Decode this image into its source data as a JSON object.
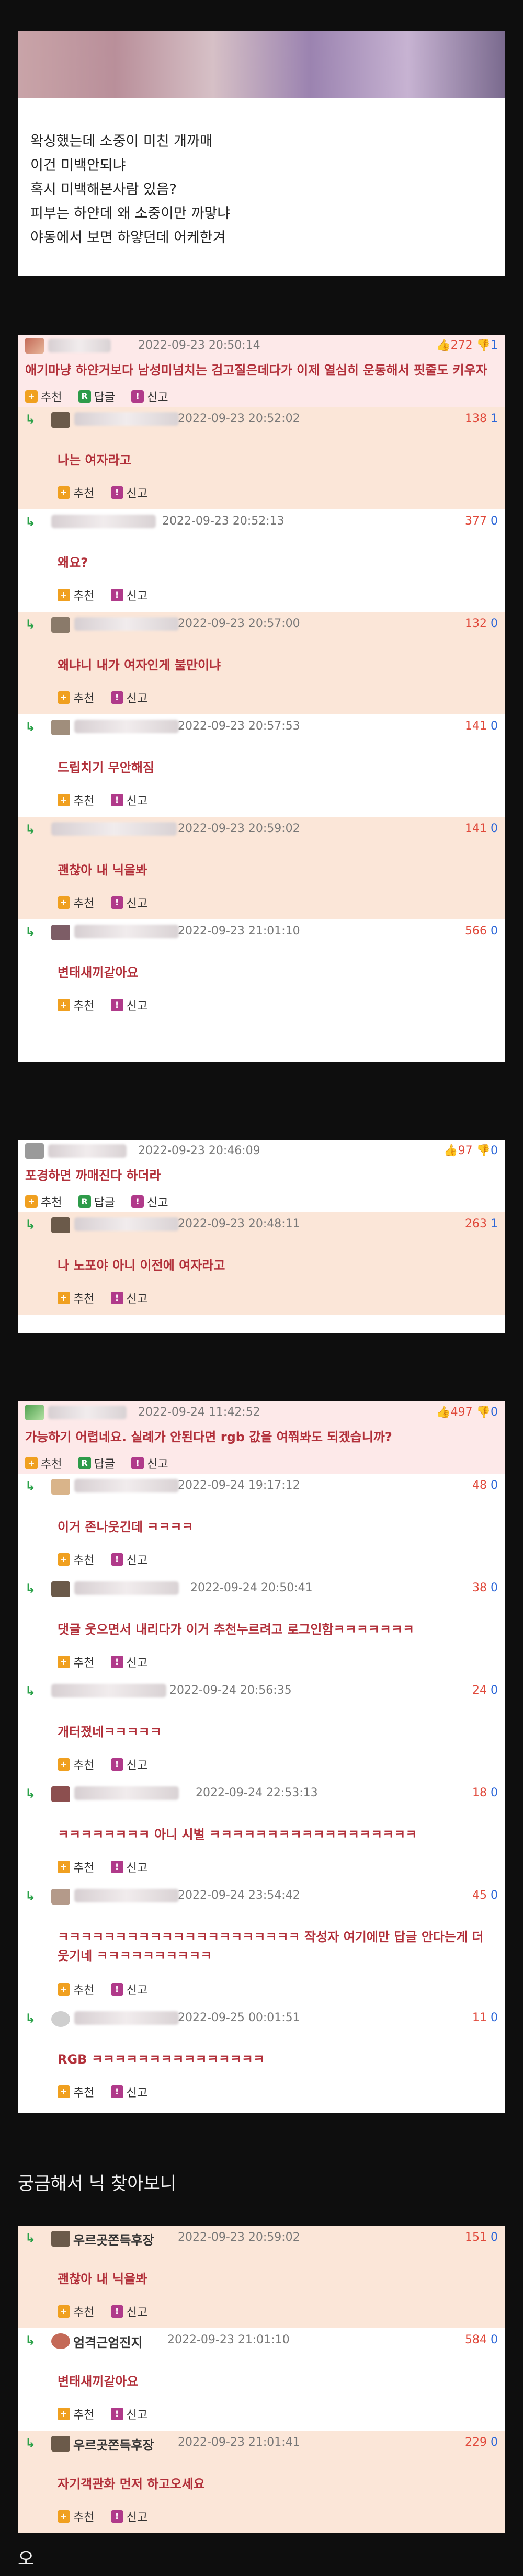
{
  "caption": {
    "lines": [
      "왁싱했는데 소중이 미친 개까매",
      "이건 미백안되냐",
      "혹시 미백해본사람 있음?",
      "피부는 하얀데 왜 소중이만 까맣냐",
      "야동에서 보면 하얗던데 어케한겨"
    ]
  },
  "labels": {
    "rec": "추천",
    "ans": "답글",
    "rep": "신고"
  },
  "thread1": {
    "ts": "2022-09-23 20:50:14",
    "up": "272",
    "down": "1",
    "text": "애기마냥 하얀거보다 남성미넘치는 검고질은데다가 이제 열심히 운동해서 핏줄도 키우자",
    "replies": [
      {
        "ts": "2022-09-23 20:52:02",
        "text": "나는 여자라고",
        "up": "138",
        "down": "1"
      },
      {
        "ts": "2022-09-23 20:52:13",
        "text": "왜요?",
        "up": "377",
        "down": "0"
      },
      {
        "ts": "2022-09-23 20:57:00",
        "text": "왜냐니 내가 여자인게 불만이냐",
        "up": "132",
        "down": "0"
      },
      {
        "ts": "2022-09-23 20:57:53",
        "text": "드립치기 무안해짐",
        "up": "141",
        "down": "0"
      },
      {
        "ts": "2022-09-23 20:59:02",
        "text": "괜찮아 내 닉을봐",
        "up": "141",
        "down": "0"
      },
      {
        "ts": "2022-09-23 21:01:10",
        "text": "변태새끼같아요",
        "up": "566",
        "down": "0"
      }
    ]
  },
  "thread2": {
    "ts": "2022-09-23 20:46:09",
    "up": "97",
    "down": "0",
    "text": "포경하면 까매진다 하더라",
    "replies": [
      {
        "ts": "2022-09-23 20:48:11",
        "text": "나 노포야 아니 이전에 여자라고",
        "up": "263",
        "down": "1"
      }
    ]
  },
  "thread3": {
    "ts": "2022-09-24 11:42:52",
    "up": "497",
    "down": "0",
    "text": "가능하기 어렵네요. 실례가 안된다면 rgb 값을 여쭤봐도 되겠습니까?",
    "replies": [
      {
        "ts": "2022-09-24 19:17:12",
        "text": "이거 존나웃긴데 ㅋㅋㅋㅋ",
        "up": "48",
        "down": "0"
      },
      {
        "ts": "2022-09-24 20:50:41",
        "text": "댓글 웃으면서 내리다가 이거 추천누르려고 로그인함ㅋㅋㅋㅋㅋㅋㅋ",
        "up": "38",
        "down": "0"
      },
      {
        "ts": "2022-09-24 20:56:35",
        "text": "개터졌네ㅋㅋㅋㅋㅋ",
        "up": "24",
        "down": "0"
      },
      {
        "ts": "2022-09-24 22:53:13",
        "text": "ㅋㅋㅋㅋㅋㅋㅋㅋ 아니 시벌 ㅋㅋㅋㅋㅋㅋㅋㅋㅋㅋㅋㅋㅋㅋㅋㅋㅋㅋ",
        "up": "18",
        "down": "0"
      },
      {
        "ts": "2022-09-24 23:54:42",
        "text": "ㅋㅋㅋㅋㅋㅋㅋㅋㅋㅋㅋㅋㅋㅋㅋㅋㅋㅋㅋㅋㅋ 작성자 여기에만 답글 안다는게 더 웃기네 ㅋㅋㅋㅋㅋㅋㅋㅋㅋㅋ",
        "up": "45",
        "down": "0"
      },
      {
        "ts": "2022-09-25 00:01:51",
        "text": "RGB ㅋㅋㅋㅋㅋㅋㅋㅋㅋㅋㅋㅋㅋㅋㅋ",
        "up": "11",
        "down": "0"
      }
    ]
  },
  "section": {
    "title": "궁금해서 닉 찾아보니",
    "footer": "오"
  },
  "thread4": {
    "replies": [
      {
        "nick": "우르곳쫀득후장",
        "ts": "2022-09-23 20:59:02",
        "text": "괜찮아 내 닉을봐",
        "up": "151",
        "down": "0"
      },
      {
        "nick": "엄격근엄진지",
        "ts": "2022-09-23 21:01:10",
        "text": "변태새끼같아요",
        "up": "584",
        "down": "0"
      },
      {
        "nick": "우르곳쫀득후장",
        "ts": "2022-09-23 21:01:41",
        "text": "자기객관화 먼저 하고오세요",
        "up": "229",
        "down": "0"
      }
    ]
  }
}
